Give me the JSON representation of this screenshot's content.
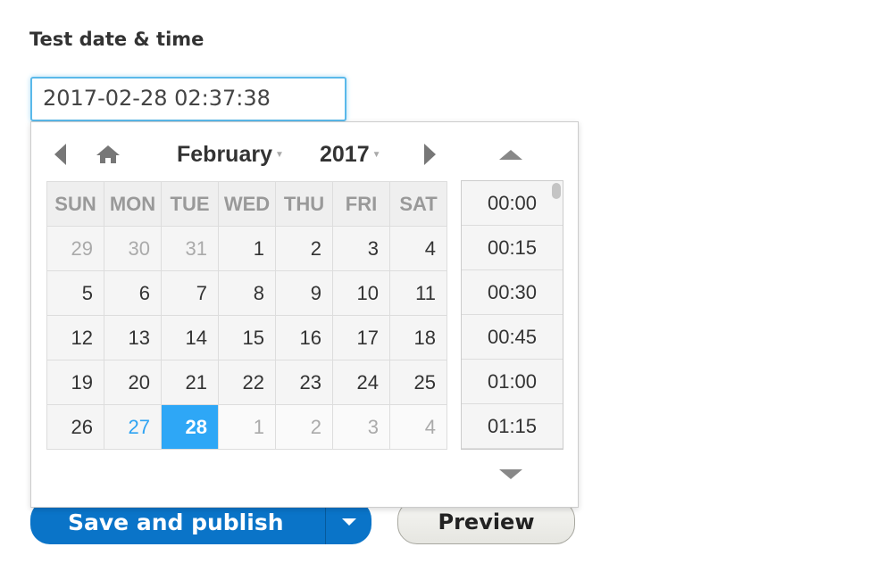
{
  "field": {
    "label": "Test date & time",
    "value": "2017-02-28 02:37:38"
  },
  "picker": {
    "month": "February",
    "year": "2017",
    "weekdays": [
      "SUN",
      "MON",
      "TUE",
      "WED",
      "THU",
      "FRI",
      "SAT"
    ],
    "weeks": [
      [
        {
          "d": "29",
          "t": "prev"
        },
        {
          "d": "30",
          "t": "prev"
        },
        {
          "d": "31",
          "t": "prev"
        },
        {
          "d": "1"
        },
        {
          "d": "2"
        },
        {
          "d": "3"
        },
        {
          "d": "4"
        }
      ],
      [
        {
          "d": "5"
        },
        {
          "d": "6"
        },
        {
          "d": "7"
        },
        {
          "d": "8"
        },
        {
          "d": "9"
        },
        {
          "d": "10"
        },
        {
          "d": "11"
        }
      ],
      [
        {
          "d": "12"
        },
        {
          "d": "13"
        },
        {
          "d": "14"
        },
        {
          "d": "15"
        },
        {
          "d": "16"
        },
        {
          "d": "17"
        },
        {
          "d": "18"
        }
      ],
      [
        {
          "d": "19"
        },
        {
          "d": "20"
        },
        {
          "d": "21"
        },
        {
          "d": "22"
        },
        {
          "d": "23"
        },
        {
          "d": "24"
        },
        {
          "d": "25"
        }
      ],
      [
        {
          "d": "26"
        },
        {
          "d": "27",
          "t": "today"
        },
        {
          "d": "28",
          "t": "selected"
        },
        {
          "d": "1",
          "t": "next"
        },
        {
          "d": "2",
          "t": "next"
        },
        {
          "d": "3",
          "t": "next"
        },
        {
          "d": "4",
          "t": "next"
        }
      ]
    ],
    "times": [
      "00:00",
      "00:15",
      "00:30",
      "00:45",
      "01:00",
      "01:15"
    ],
    "icons": {
      "prev": "triangle-left-icon",
      "home": "home-icon",
      "next": "triangle-right-icon",
      "up": "triangle-up-icon",
      "down": "triangle-down-icon"
    }
  },
  "actions": {
    "save": "Save and publish",
    "preview": "Preview"
  },
  "colors": {
    "accent": "#0a74c8",
    "selected": "#2ea7f6",
    "today": "#2ea3f2"
  }
}
